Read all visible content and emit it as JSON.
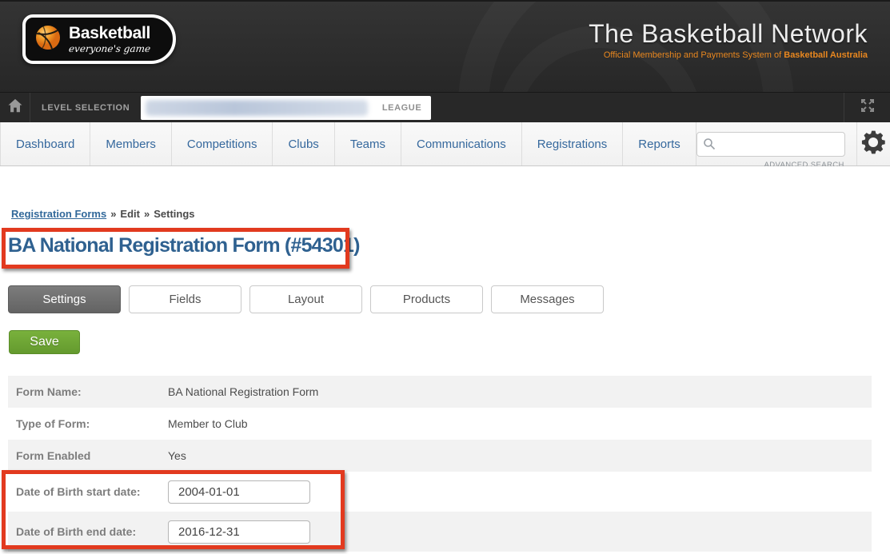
{
  "brand": {
    "logo_title": "Basketball",
    "logo_tagline": "everyone's game",
    "network_title": "The Basketball Network",
    "network_subtitle": "Official Membership and Payments System of ",
    "network_subtitle_bold": "Basketball Australia"
  },
  "level_bar": {
    "label": "LEVEL SELECTION",
    "level_type": "LEAGUE"
  },
  "nav": {
    "items": [
      "Dashboard",
      "Members",
      "Competitions",
      "Clubs",
      "Teams",
      "Communications",
      "Registrations",
      "Reports"
    ],
    "search_value": "",
    "advanced_search_label": "ADVANCED SEARCH"
  },
  "breadcrumb": {
    "link": "Registration Forms",
    "separator": "»",
    "step1": "Edit",
    "step2": "Settings"
  },
  "page": {
    "title": "BA National Registration Form (#54301)",
    "tabs": [
      {
        "label": "Settings",
        "active": true
      },
      {
        "label": "Fields",
        "active": false
      },
      {
        "label": "Layout",
        "active": false
      },
      {
        "label": "Products",
        "active": false
      },
      {
        "label": "Messages",
        "active": false
      }
    ],
    "save_label": "Save"
  },
  "form": {
    "rows": [
      {
        "label": "Form Name:",
        "value": "BA National Registration Form",
        "type": "text"
      },
      {
        "label": "Type of Form:",
        "value": "Member to Club",
        "type": "text"
      },
      {
        "label": "Form Enabled",
        "value": "Yes",
        "type": "text"
      },
      {
        "label": "Date of Birth start date:",
        "value": "2004-01-01",
        "type": "input"
      },
      {
        "label": "Date of Birth end date:",
        "value": "2016-12-31",
        "type": "input"
      }
    ]
  },
  "icons": {
    "home": "home-icon",
    "expand": "expand-icon",
    "search": "search-icon",
    "gear": "gear-icon",
    "basketball": "basketball-icon"
  },
  "colors": {
    "annotation_red": "#e23a1f",
    "nav_link_blue": "#35689d",
    "title_blue": "#2f6190",
    "save_green": "#6ba52f",
    "active_tab_gray": "#6e6e6e",
    "subtitle_orange": "#e8871f",
    "header_dark": "#2d2d2d"
  }
}
